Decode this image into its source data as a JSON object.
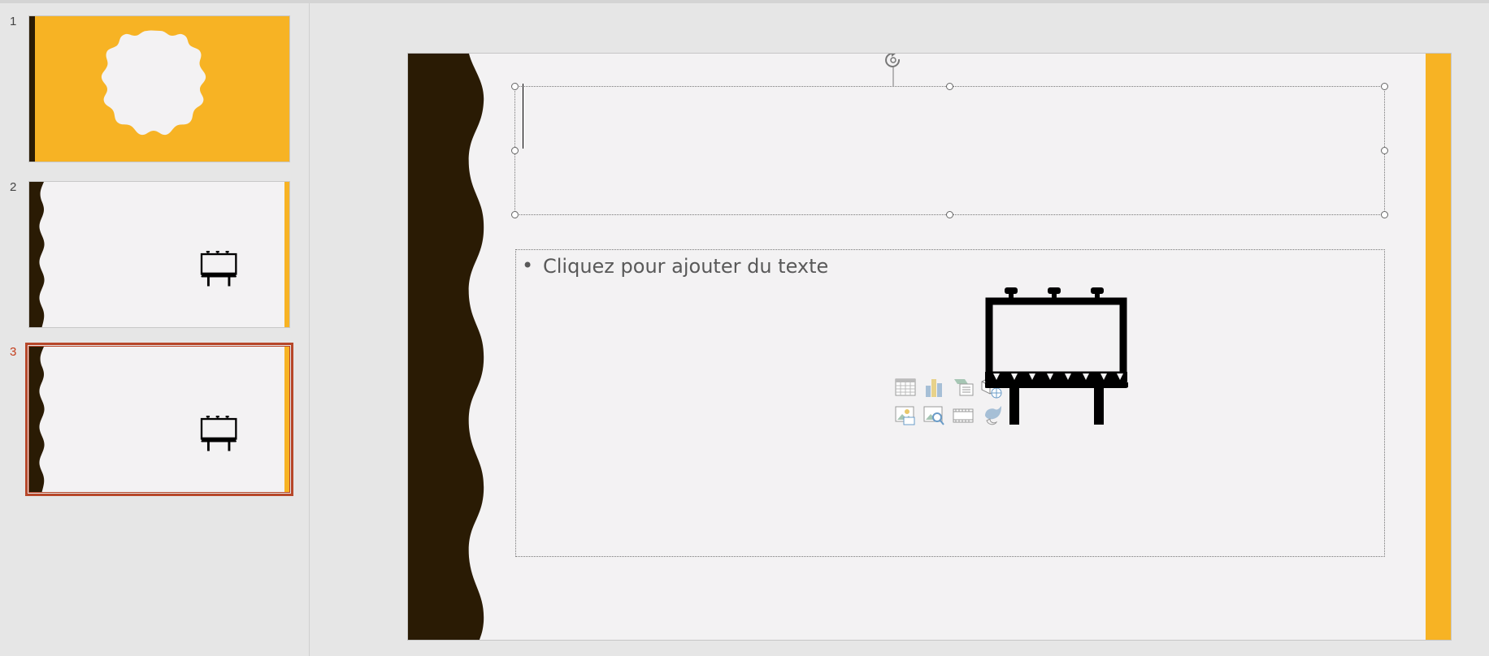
{
  "slide_panel": {
    "slides": [
      {
        "number": "1",
        "selected": false
      },
      {
        "number": "2",
        "selected": false
      },
      {
        "number": "3",
        "selected": true
      }
    ]
  },
  "slide": {
    "body_placeholder": "Cliquez pour ajouter du texte",
    "bullet": "•"
  },
  "content_icons": [
    "table-icon",
    "chart-icon",
    "smartart-icon",
    "3d-model-icon",
    "pictures-icon",
    "online-pictures-icon",
    "video-icon",
    "icons-insert-icon"
  ],
  "colors": {
    "accent_yellow": "#F7B324",
    "dark_brown": "#2A1B04",
    "slide_bg": "#F3F2F3",
    "selection": "#B7472A"
  }
}
